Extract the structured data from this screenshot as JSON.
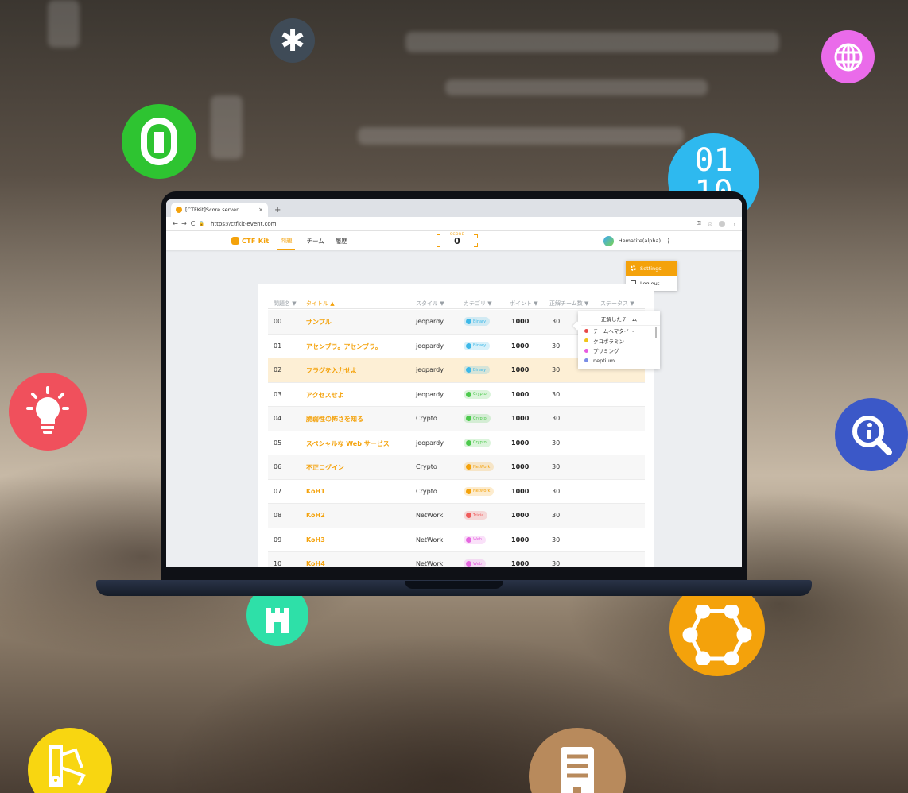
{
  "browser": {
    "tab_title": "[CTFKit]Score server",
    "tab_close": "×",
    "new_tab": "+",
    "nav_back": "←",
    "nav_forward": "→",
    "reload": "C",
    "lock": "🔒",
    "url": "https://ctfkit-event.com",
    "key_icon": "⚿",
    "star_icon": "☆",
    "menu_icon": "⋮"
  },
  "app": {
    "logo": "CTF Kit",
    "nav": [
      "問題",
      "チーム",
      "履歴"
    ],
    "score_label": "SCORE",
    "score_value": "0",
    "user_name": "Hematite(alpha)",
    "user_menu_icon": "⋮"
  },
  "dropdown": {
    "items": [
      "Settings",
      "Log out"
    ]
  },
  "table": {
    "headers": [
      "問題名 ▼",
      "タイトル ▲",
      "スタイル ▼",
      "カテゴリ ▼",
      "ポイント ▼",
      "正解チーム数 ▼",
      "ステータス ▼"
    ],
    "rows": [
      {
        "id": "00",
        "title": "サンプル",
        "style": "jeopardy",
        "category": "Binary",
        "points": "1000",
        "solved": "30"
      },
      {
        "id": "01",
        "title": "アセンブラ。アセンブラ。",
        "style": "jeopardy",
        "category": "Binary",
        "points": "1000",
        "solved": "30"
      },
      {
        "id": "02",
        "title": "フラグを入力せよ",
        "style": "jeopardy",
        "category": "Binary",
        "points": "1000",
        "solved": "30"
      },
      {
        "id": "03",
        "title": "アクセスせよ",
        "style": "jeopardy",
        "category": "Crypto",
        "points": "1000",
        "solved": "30"
      },
      {
        "id": "04",
        "title": "脆弱性の怖さを知る",
        "style": "Crypto",
        "category": "Crypto",
        "points": "1000",
        "solved": "30"
      },
      {
        "id": "05",
        "title": "スペシャルな Web サービス",
        "style": "jeopardy",
        "category": "Crypto",
        "points": "1000",
        "solved": "30"
      },
      {
        "id": "06",
        "title": "不正ログイン",
        "style": "Crypto",
        "category": "NetWork",
        "points": "1000",
        "solved": "30"
      },
      {
        "id": "07",
        "title": "KoH1",
        "style": "Crypto",
        "category": "NetWork",
        "points": "1000",
        "solved": "30"
      },
      {
        "id": "08",
        "title": "KoH2",
        "style": "NetWork",
        "category": "Trivia",
        "points": "1000",
        "solved": "30"
      },
      {
        "id": "09",
        "title": "KoH3",
        "style": "NetWork",
        "category": "Web",
        "points": "1000",
        "solved": "30"
      },
      {
        "id": "10",
        "title": "KoH4",
        "style": "NetWork",
        "category": "Web",
        "points": "1000",
        "solved": "30"
      }
    ]
  },
  "solved_popup": {
    "title": "正解したチーム",
    "teams": [
      {
        "name": "チームヘマタイト",
        "color": "#e84848"
      },
      {
        "name": "クコボラミン",
        "color": "#f0c419"
      },
      {
        "name": "プリミング",
        "color": "#e85ae0"
      },
      {
        "name": "neptium",
        "color": "#7a8de6"
      }
    ]
  },
  "colors": {
    "accent": "#f4a20b",
    "binary": "#3db8e8",
    "crypto": "#4cc94c",
    "network": "#f4a20b",
    "trivia": "#ef5b5b",
    "web": "#e567e0"
  },
  "floating_icons": {
    "asterisk": "✱",
    "binary_digits": "01\n10",
    "lightbulb": "lightbulb-icon",
    "link": "link-icon",
    "globe": "globe-icon",
    "search_info": "search-info-icon",
    "castle": "castle-icon",
    "network": "network-icon",
    "palette": "palette-icon",
    "document": "document-icon"
  }
}
